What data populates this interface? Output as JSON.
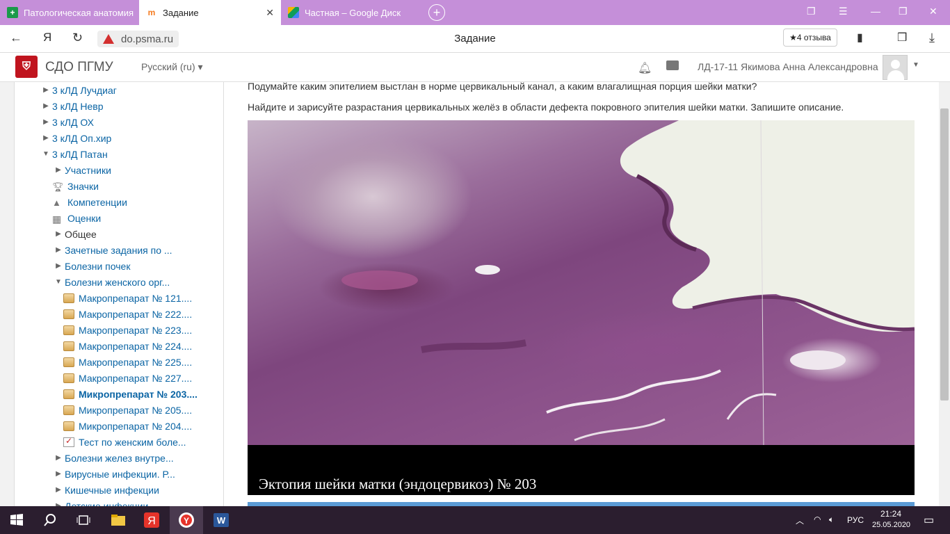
{
  "browser": {
    "tabs": [
      {
        "label": "Патологическая анатомия",
        "active": false
      },
      {
        "label": "Задание",
        "active": true
      },
      {
        "label": "Частная – Google Диск",
        "active": false
      }
    ],
    "url": "do.psma.ru",
    "page_title": "Задание",
    "reviews": "★4 отзыва",
    "yandex_btn": "Я"
  },
  "moodle": {
    "brand": "СДО ПГМУ",
    "language": "Русский (ru)",
    "user": "ЛД-17-11 Якимова Анна Александровна"
  },
  "sidebar": {
    "items": [
      {
        "label": "3 кЛД Лучдиаг",
        "indent": 0,
        "type": "collapsed"
      },
      {
        "label": "3 кЛД Невр",
        "indent": 0,
        "type": "collapsed"
      },
      {
        "label": "3 кЛД ОХ",
        "indent": 0,
        "type": "collapsed"
      },
      {
        "label": "3 кЛД Оп.хир",
        "indent": 0,
        "type": "collapsed"
      },
      {
        "label": "3 кЛД Патан",
        "indent": 0,
        "type": "expanded"
      },
      {
        "label": "Участники",
        "indent": 1,
        "type": "collapsed"
      },
      {
        "label": "Значки",
        "indent": 1,
        "type": "trophy"
      },
      {
        "label": "Компетенции",
        "indent": 1,
        "type": "competency"
      },
      {
        "label": "Оценки",
        "indent": 1,
        "type": "grades"
      },
      {
        "label": "Общее",
        "indent": 1,
        "type": "collapsed-plain"
      },
      {
        "label": "Зачетные задания по ...",
        "indent": 1,
        "type": "collapsed"
      },
      {
        "label": "Болезни почек",
        "indent": 1,
        "type": "collapsed"
      },
      {
        "label": "Болезни женского орг...",
        "indent": 1,
        "type": "expanded"
      },
      {
        "label": "Макропрепарат № 121....",
        "indent": 2,
        "type": "page"
      },
      {
        "label": "Макропрепарат № 222....",
        "indent": 2,
        "type": "page"
      },
      {
        "label": "Макропрепарат № 223....",
        "indent": 2,
        "type": "page"
      },
      {
        "label": "Макропрепарат № 224....",
        "indent": 2,
        "type": "page"
      },
      {
        "label": "Макропрепарат № 225....",
        "indent": 2,
        "type": "page"
      },
      {
        "label": "Макропрепарат № 227....",
        "indent": 2,
        "type": "page"
      },
      {
        "label": "Микропрепарат № 203....",
        "indent": 2,
        "type": "page-current"
      },
      {
        "label": "Микропрепарат № 205....",
        "indent": 2,
        "type": "page"
      },
      {
        "label": "Микропрепарат № 204....",
        "indent": 2,
        "type": "page"
      },
      {
        "label": "Тест по женским боле...",
        "indent": 2,
        "type": "quiz"
      },
      {
        "label": "Болезни желез внутре...",
        "indent": 1,
        "type": "collapsed"
      },
      {
        "label": "Вирусные инфекции. Р...",
        "indent": 1,
        "type": "collapsed"
      },
      {
        "label": "Кишечные инфекции",
        "indent": 1,
        "type": "collapsed"
      },
      {
        "label": "Детские инфекции",
        "indent": 1,
        "type": "collapsed"
      }
    ]
  },
  "content": {
    "para1": "Подумайте каким эпителием выстлан в норме цервикальный канал, а каким влагалищная порция шейки матки?",
    "para2": "Найдите и зарисуйте разрастания цервикальных желёз в области дефекта покровного эпителия шейки матки. Запишите описание.",
    "caption": "Эктопия шейки матки (эндоцервикоз) № 203"
  },
  "taskbar": {
    "lang": "РУС",
    "time": "21:24",
    "date": "25.05.2020"
  }
}
